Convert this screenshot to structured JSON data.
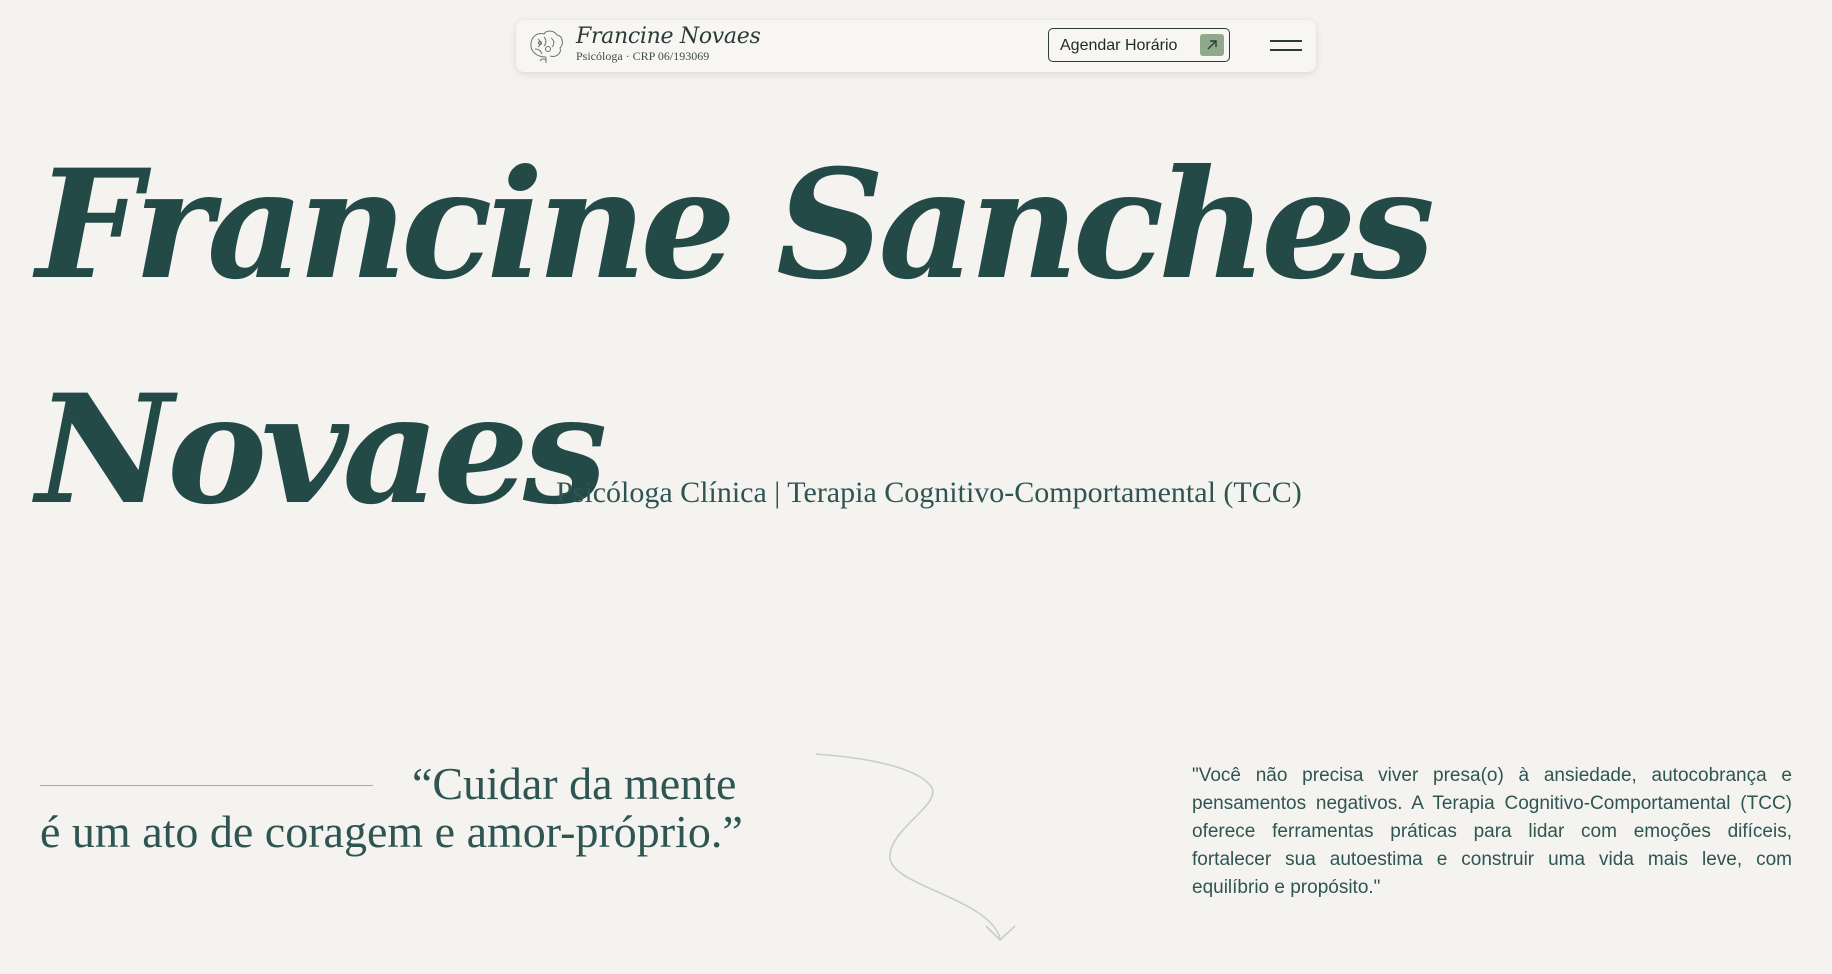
{
  "header": {
    "brand_name": "Francine Novaes",
    "brand_subtitle": "Psicóloga · CRP 06/193069",
    "logo_icon": "brain-flower-icon",
    "cta_label": "Agendar Horário",
    "cta_icon": "arrow-up-right-icon",
    "menu_icon": "hamburger-menu-icon"
  },
  "hero": {
    "name_line1": "Francine Sanches",
    "name_line2": "Novaes",
    "tagline": "Psicóloga Clínica | Terapia Cognitivo-Comportamental (TCC)"
  },
  "quote": {
    "line1": "“Cuidar da mente",
    "line2": "é um ato de coragem e amor-próprio.”"
  },
  "mission": {
    "text": "\"Você não precisa viver presa(o) à ansiedade, autocobrança e pensamentos negativos. A Terapia Cognitivo-Comportamental (TCC) oferece ferramentas práticas para lidar com emoções difíceis, fortalecer sua autoestima e construir uma vida mais leve, com equilíbrio e propósito.\""
  },
  "colors": {
    "background": "#f4f3ef",
    "primary_text": "#234a47",
    "accent_green": "#8fa98a"
  }
}
